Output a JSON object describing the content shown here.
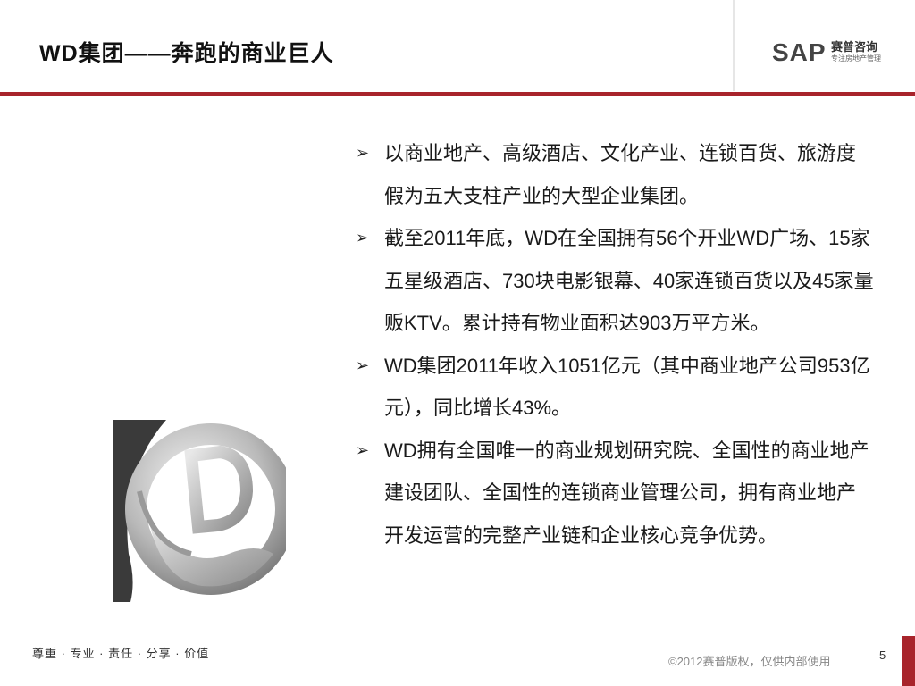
{
  "slide": {
    "title": "WD集团——奔跑的商业巨人",
    "page_number": "5"
  },
  "logo": {
    "brand": "SAP",
    "name": "赛普咨询",
    "tagline": "专注房地产管理"
  },
  "bullets": [
    "以商业地产、高级酒店、文化产业、连锁百货、旅游度假为五大支柱产业的大型企业集团。",
    "截至2011年底，WD在全国拥有56个开业WD广场、15家五星级酒店、730块电影银幕、40家连锁百货以及45家量贩KTV。累计持有物业面积达903万平方米。",
    "WD集团2011年收入1051亿元（其中商业地产公司953亿元），同比增长43%。",
    "WD拥有全国唯一的商业规划研究院、全国性的商业地产建设团队、全国性的连锁商业管理公司，拥有商业地产开发运营的完整产业链和企业核心竞争优势。"
  ],
  "footer": {
    "values": "尊重 · 专业 · 责任 · 分享 · 价值",
    "copyright": "©2012赛普版权，仅供内部使用"
  },
  "colors": {
    "accent_red": "#a8242b"
  },
  "icons": {
    "bullet": "arrow-right-icon",
    "emblem": "company-emblem"
  }
}
